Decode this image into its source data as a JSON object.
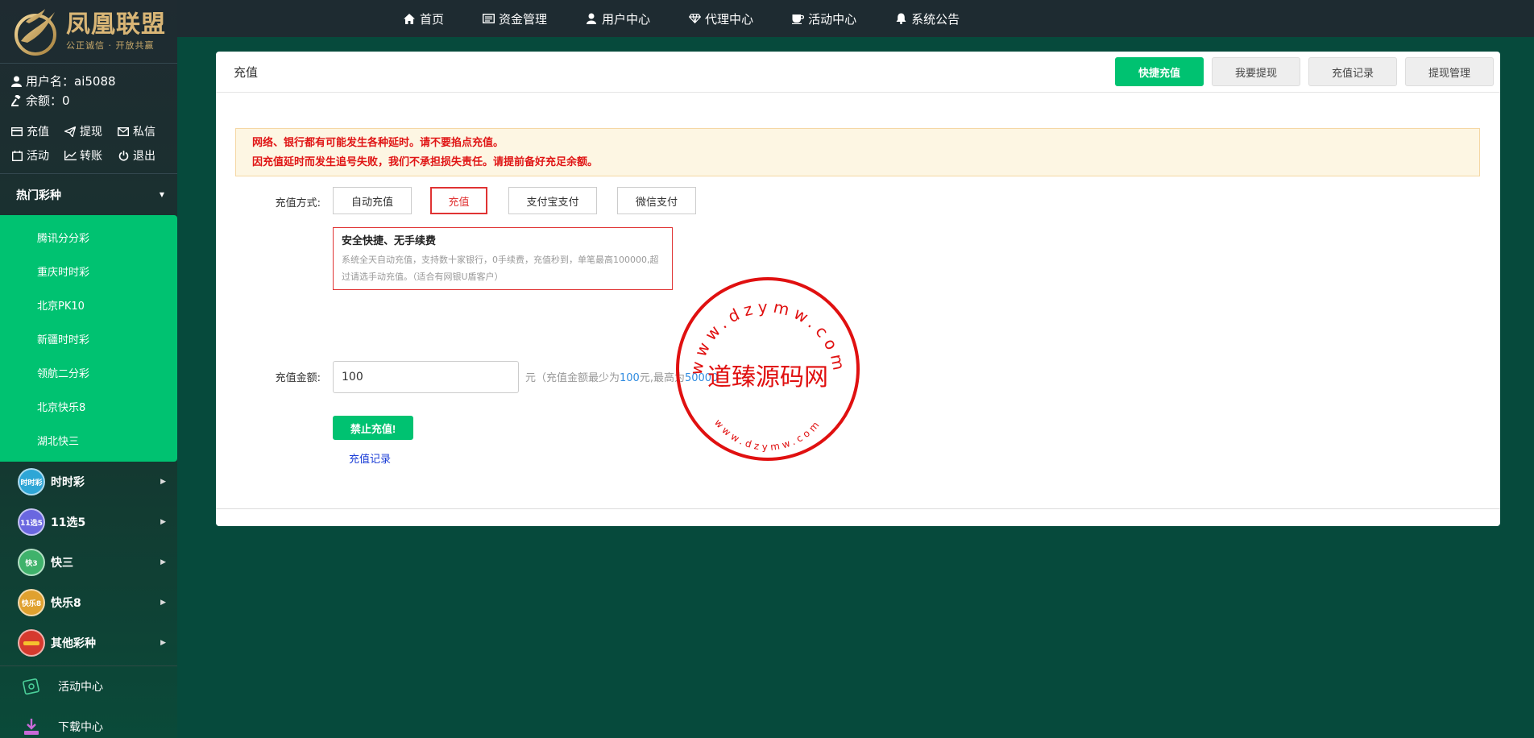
{
  "sidebar": {
    "brand_name": "凤凰联盟",
    "brand_slogan": "公正诚信 · 开放共赢",
    "username_label": "用户名：",
    "username": "ai5088",
    "balance_label": "余额：",
    "balance": "0",
    "quick_actions": [
      {
        "label": "充值",
        "icon": "card-icon"
      },
      {
        "label": "提现",
        "icon": "send-icon"
      },
      {
        "label": "私信",
        "icon": "mail-icon"
      },
      {
        "label": "活动",
        "icon": "calendar-icon"
      },
      {
        "label": "转账",
        "icon": "chart-icon"
      },
      {
        "label": "退出",
        "icon": "power-icon"
      }
    ],
    "hot_header": "热门彩种",
    "hot_items": [
      "腾讯分分彩",
      "重庆时时彩",
      "北京PK10",
      "新疆时时彩",
      "领航二分彩",
      "北京快乐8",
      "湖北快三"
    ],
    "categories": [
      {
        "label": "时时彩",
        "icon_text": "时时彩",
        "color": "#2ea6d6"
      },
      {
        "label": "11选5",
        "icon_text": "11选5",
        "color": "#6a67e0"
      },
      {
        "label": "快三",
        "icon_text": "快3",
        "color": "#3fb26b"
      },
      {
        "label": "快乐8",
        "icon_text": "快乐8",
        "color": "#e0a12f"
      },
      {
        "label": "其他彩种",
        "icon_text": "",
        "color": "#d63a2e"
      }
    ],
    "extra": [
      {
        "label": "活动中心",
        "icon": "gift-card-icon"
      },
      {
        "label": "下载中心",
        "icon": "download-icon"
      }
    ]
  },
  "topnav": [
    {
      "label": "首页",
      "icon": "home-icon"
    },
    {
      "label": "资金管理",
      "icon": "wallet-icon"
    },
    {
      "label": "用户中心",
      "icon": "user-icon"
    },
    {
      "label": "代理中心",
      "icon": "diamond-icon"
    },
    {
      "label": "活动中心",
      "icon": "coffee-icon"
    },
    {
      "label": "系统公告",
      "icon": "bell-icon"
    }
  ],
  "panel": {
    "title": "充值",
    "tabs": [
      "快捷充值",
      "我要提现",
      "充值记录",
      "提现管理"
    ],
    "warning_lines": [
      "网络、银行都有可能发生各种延时。请不要掐点充值。",
      "因充值延时而发生追号失败，我们不承担损失责任。请提前备好充足余额。"
    ],
    "method_label": "充值方式:",
    "methods": [
      "自动充值",
      "充值",
      "支付宝支付",
      "微信支付"
    ],
    "method_desc_title": "安全快捷、无手续费",
    "method_desc_text": "系统全天自动充值，支持数十家银行，0手续费，充值秒到，单笔最高100000,超过请选手动充值。（适合有网银U盾客户）",
    "amount_label": "充值金额:",
    "amount_value": "100",
    "hint_prefix": "元（充值金额最少为",
    "hint_min": "100",
    "hint_mid": "元,最高为",
    "hint_max": "50000",
    "submit_label": "禁止充值!",
    "record_link": "充值记录"
  },
  "watermark": {
    "center_text": "道臻源码网",
    "ring_text": "www.dzymw.com"
  }
}
